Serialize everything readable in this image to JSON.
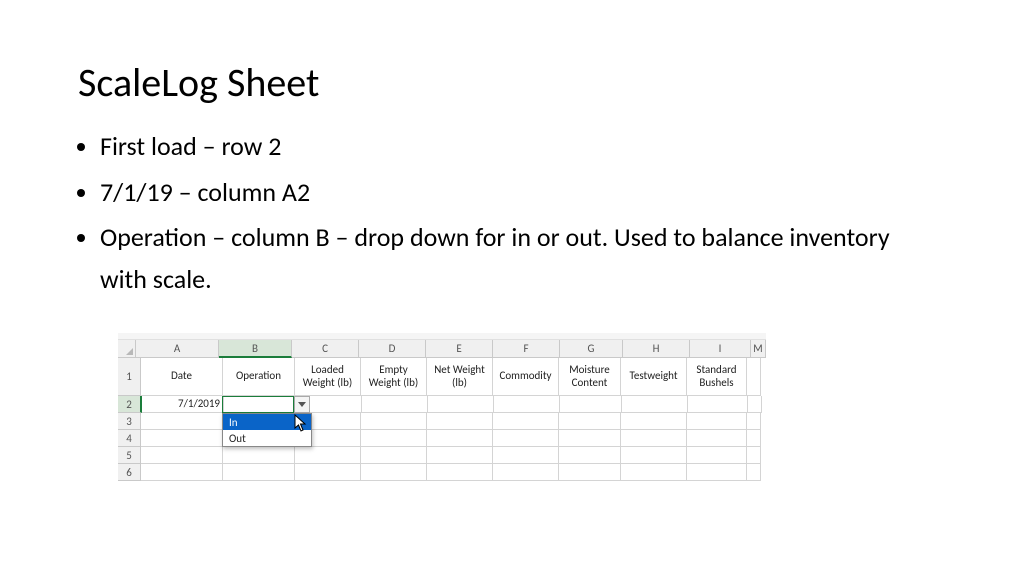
{
  "title": "ScaleLog Sheet",
  "bullets": [
    "First load – row 2",
    "7/1/19 – column A2",
    "Operation – column B – drop down for in or out. Used to balance inventory with scale."
  ],
  "columns": [
    "A",
    "B",
    "C",
    "D",
    "E",
    "F",
    "G",
    "H",
    "I",
    "M"
  ],
  "headers": {
    "A": "Date",
    "B": "Operation",
    "C": "Loaded Weight (lb)",
    "D": "Empty Weight (lb)",
    "E": "Net Weight (lb)",
    "F": "Commodity",
    "G": "Moisture Content",
    "H": "Testweight",
    "I": "Standard Bushels"
  },
  "row_numbers": [
    "1",
    "2",
    "3",
    "4",
    "5",
    "6"
  ],
  "data": {
    "A2": "7/1/2019"
  },
  "dropdown": {
    "options": [
      "In",
      "Out"
    ],
    "selected_index": 0
  },
  "active_column": "B",
  "active_row": "2"
}
